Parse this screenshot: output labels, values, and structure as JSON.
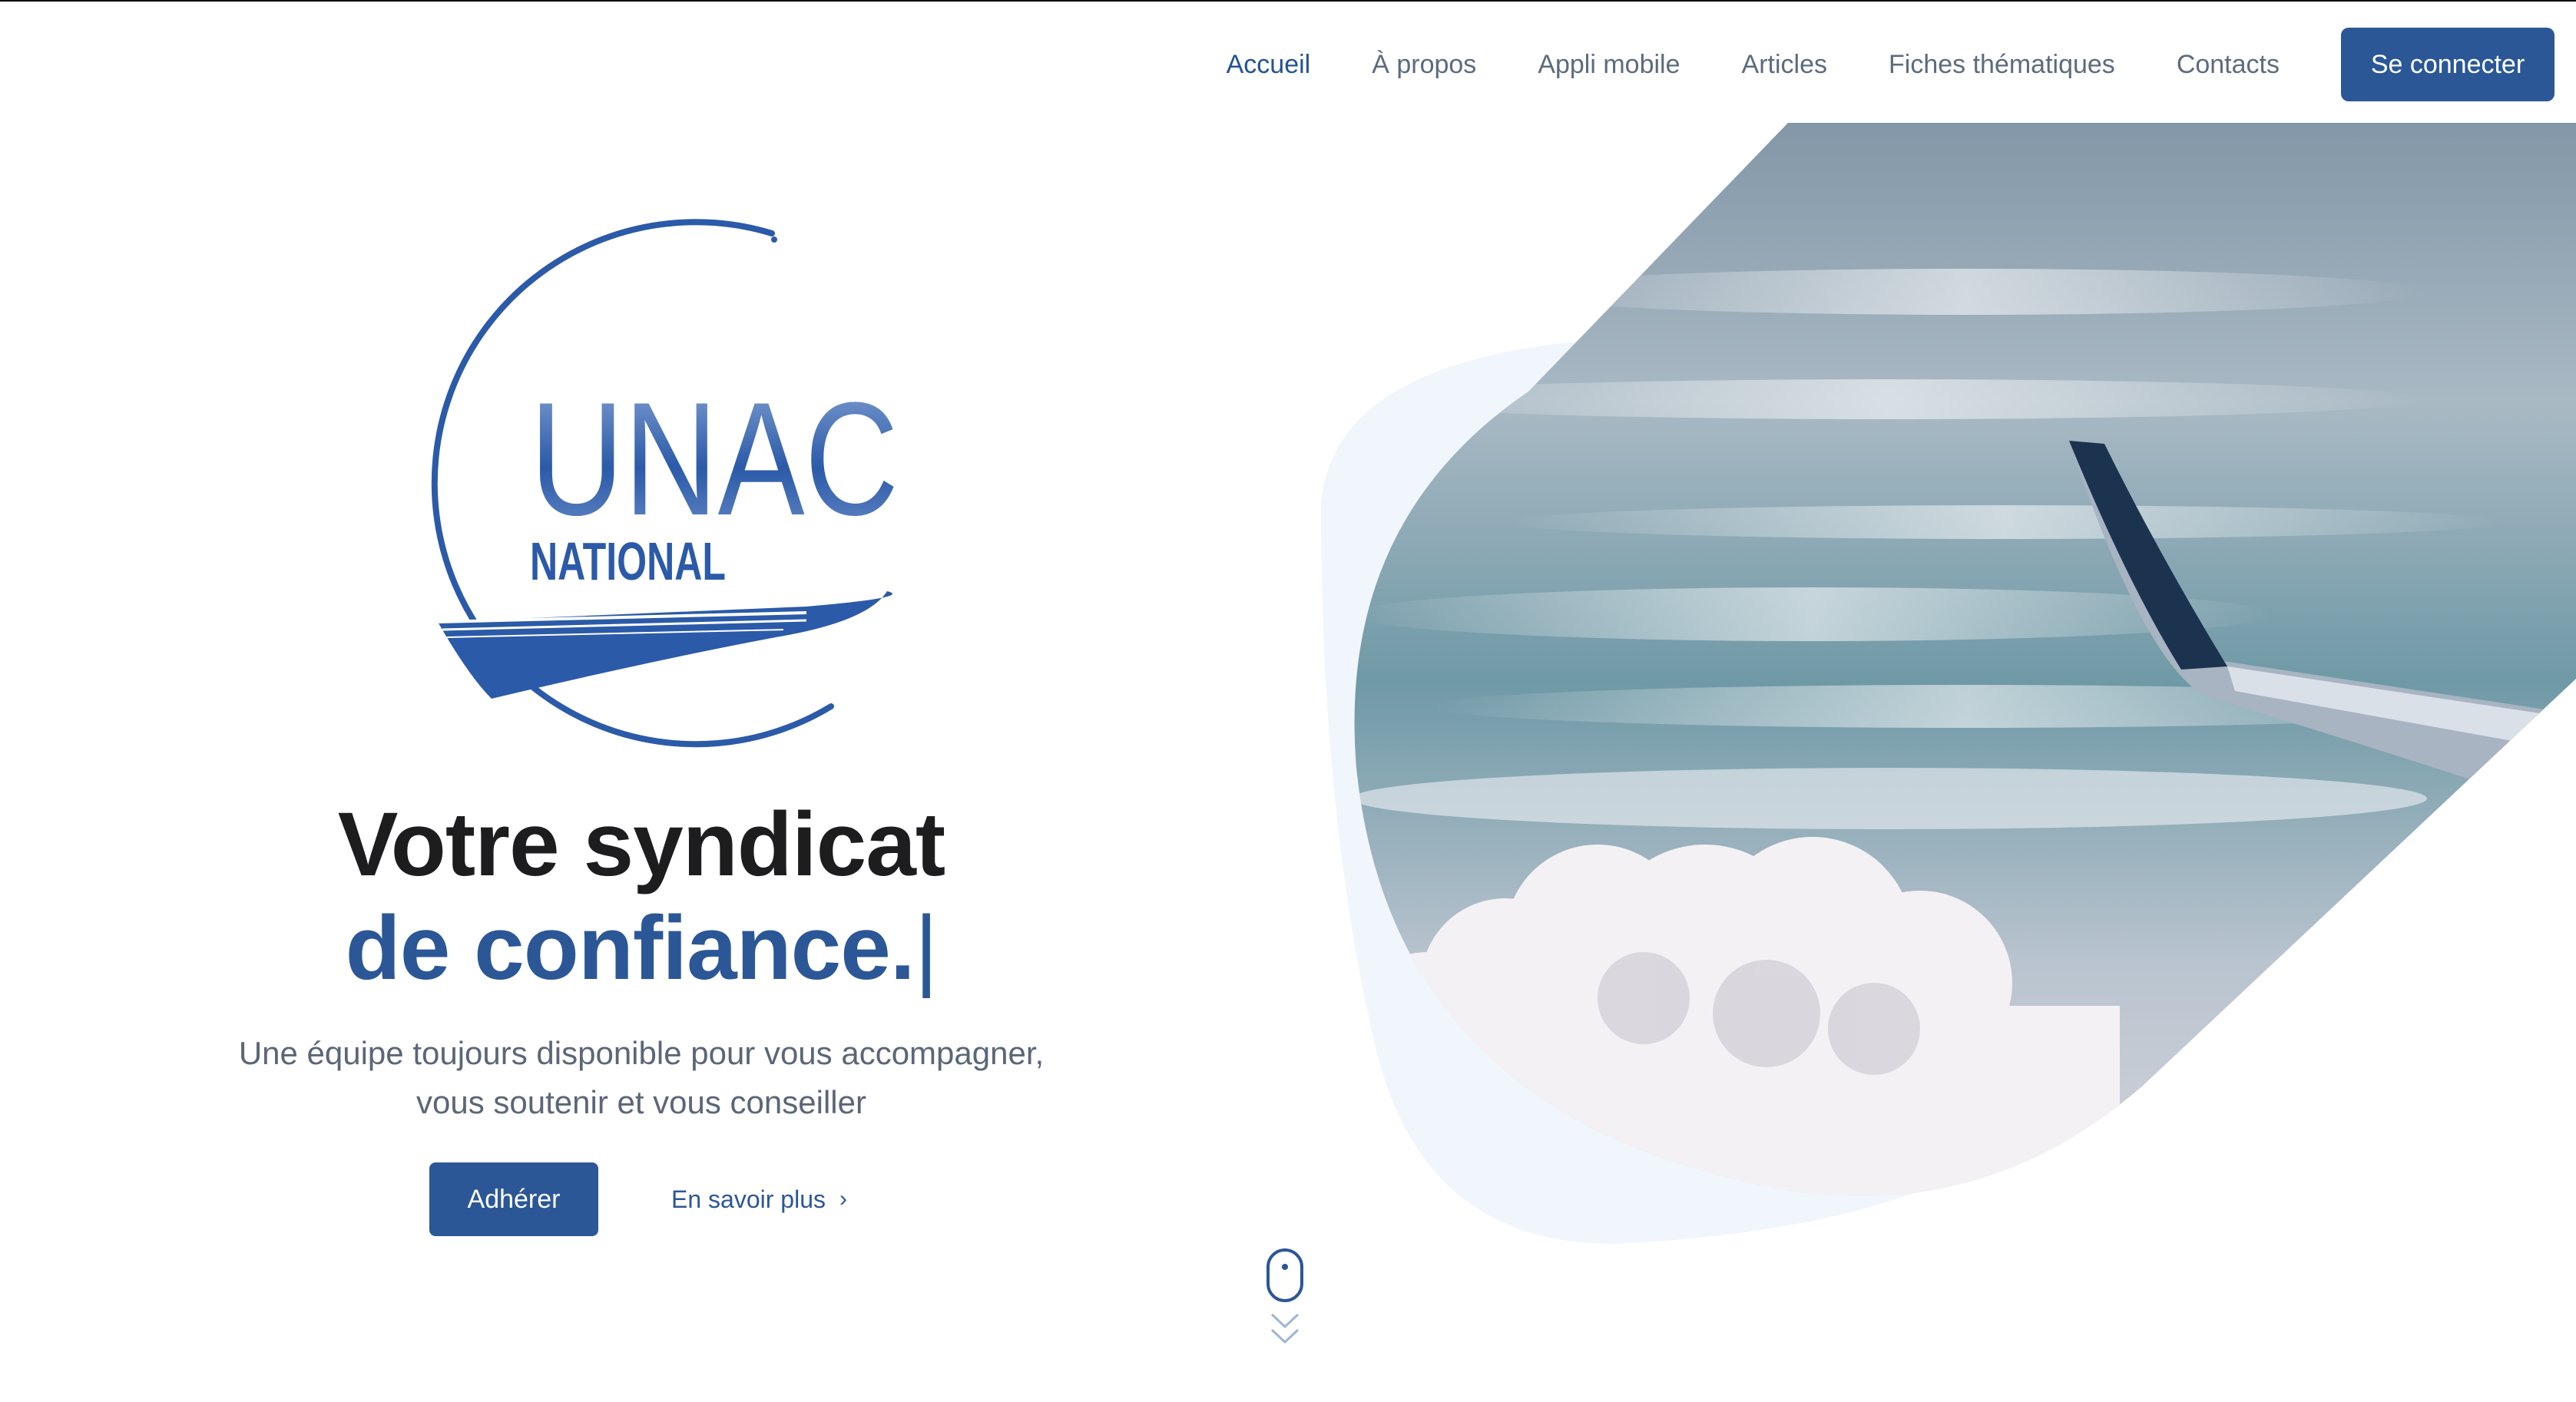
{
  "nav": {
    "items": [
      {
        "label": "Accueil",
        "active": true
      },
      {
        "label": "À propos",
        "active": false
      },
      {
        "label": "Appli mobile",
        "active": false
      },
      {
        "label": "Articles",
        "active": false
      },
      {
        "label": "Fiches thématiques",
        "active": false
      },
      {
        "label": "Contacts",
        "active": false
      }
    ],
    "login_label": "Se connecter"
  },
  "logo": {
    "title": "UNAC",
    "subtitle": "NATIONAL",
    "icon": "plane-circle-logo"
  },
  "hero": {
    "headline_line1": "Votre syndicat",
    "headline_line2": "de confiance.",
    "cursor": "|",
    "subtitle_line1": "Une équipe toujours disponible pour vous accompagner,",
    "subtitle_line2": "vous soutenir et vous conseiller",
    "primary_cta": "Adhérer",
    "secondary_cta": "En savoir plus",
    "secondary_icon": "chevron-right-icon",
    "image": "airplane-wing-over-clouds"
  },
  "scroll_indicator": {
    "icon": "mouse-scroll-icon"
  },
  "colors": {
    "brand": "#2b5797",
    "text_dark": "#1d1d1f",
    "text_muted": "#5b6678",
    "nav_text": "#5c6b7e",
    "blob": "#f1f6fd"
  }
}
